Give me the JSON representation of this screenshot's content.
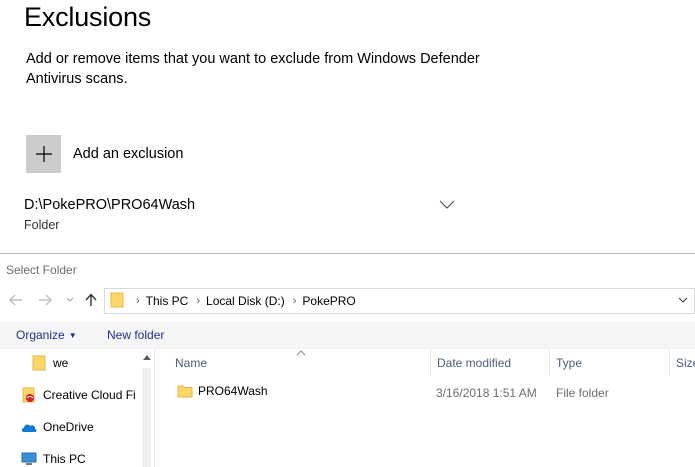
{
  "settings": {
    "title": "Exclusions",
    "description": "Add or remove items that you want to exclude from Windows Defender Antivirus scans.",
    "add_label": "Add an exclusion",
    "exclusion": {
      "path": "D:\\PokePRO\\PRO64Wash",
      "type": "Folder"
    }
  },
  "dialog": {
    "title": "Select Folder",
    "breadcrumb": [
      "This PC",
      "Local Disk (D:)",
      "PokePRO"
    ],
    "toolbar": {
      "organize": "Organize",
      "new_folder": "New folder"
    },
    "nav_pane": [
      {
        "label": "we",
        "icon": "folder-icon"
      },
      {
        "label": "Creative Cloud Fil",
        "icon": "creative-cloud-icon"
      },
      {
        "label": "OneDrive",
        "icon": "onedrive-icon"
      },
      {
        "label": "This PC",
        "icon": "computer-icon"
      }
    ],
    "columns": [
      "Name",
      "Date modified",
      "Type",
      "Size"
    ],
    "files": [
      {
        "name": "PRO64Wash",
        "date_modified": "3/16/2018 1:51 AM",
        "type": "File folder"
      }
    ]
  },
  "colors": {
    "folder_yellow": "#ffd766",
    "link_blue": "#1e3287",
    "onedrive_blue": "#0f78d4",
    "adobe_red": "#da1f26",
    "add_button_gray": "#cccccc"
  }
}
